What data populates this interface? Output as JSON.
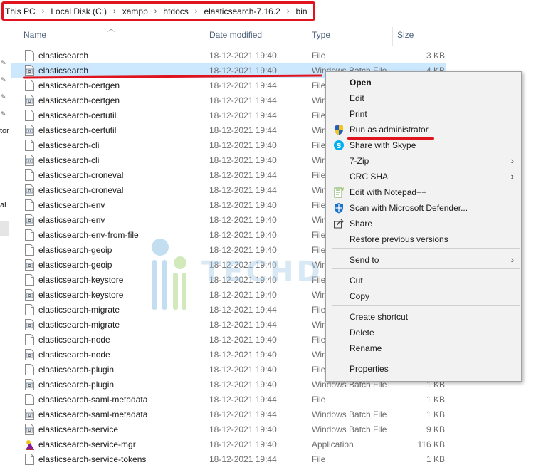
{
  "breadcrumb": [
    "This PC",
    "Local Disk (C:)",
    "xampp",
    "htdocs",
    "elasticsearch-7.16.2",
    "bin"
  ],
  "breadcrumb_separator": "›",
  "leftnav": {
    "fragments": [
      "tor",
      "al"
    ]
  },
  "columns": {
    "name": "Name",
    "date": "Date modified",
    "type": "Type",
    "size": "Size"
  },
  "files": [
    {
      "name": "elasticsearch",
      "date": "18-12-2021 19:40",
      "type": "File",
      "size": "3 KB",
      "icon": "file-icon"
    },
    {
      "name": "elasticsearch",
      "date": "18-12-2021 19:40",
      "type": "Windows Batch File",
      "size": "4 KB",
      "icon": "batch-file-icon",
      "selected": true
    },
    {
      "name": "elasticsearch-certgen",
      "date": "18-12-2021 19:44",
      "type": "File",
      "size": "",
      "icon": "file-icon"
    },
    {
      "name": "elasticsearch-certgen",
      "date": "18-12-2021 19:44",
      "type": "Win",
      "size": "",
      "icon": "batch-file-icon"
    },
    {
      "name": "elasticsearch-certutil",
      "date": "18-12-2021 19:44",
      "type": "File",
      "size": "",
      "icon": "file-icon"
    },
    {
      "name": "elasticsearch-certutil",
      "date": "18-12-2021 19:44",
      "type": "Win",
      "size": "",
      "icon": "batch-file-icon"
    },
    {
      "name": "elasticsearch-cli",
      "date": "18-12-2021 19:40",
      "type": "File",
      "size": "",
      "icon": "file-icon"
    },
    {
      "name": "elasticsearch-cli",
      "date": "18-12-2021 19:40",
      "type": "Win",
      "size": "",
      "icon": "batch-file-icon"
    },
    {
      "name": "elasticsearch-croneval",
      "date": "18-12-2021 19:44",
      "type": "File",
      "size": "",
      "icon": "file-icon"
    },
    {
      "name": "elasticsearch-croneval",
      "date": "18-12-2021 19:44",
      "type": "Win",
      "size": "",
      "icon": "batch-file-icon"
    },
    {
      "name": "elasticsearch-env",
      "date": "18-12-2021 19:40",
      "type": "File",
      "size": "",
      "icon": "file-icon"
    },
    {
      "name": "elasticsearch-env",
      "date": "18-12-2021 19:40",
      "type": "Win",
      "size": "",
      "icon": "batch-file-icon"
    },
    {
      "name": "elasticsearch-env-from-file",
      "date": "18-12-2021 19:40",
      "type": "File",
      "size": "",
      "icon": "file-icon"
    },
    {
      "name": "elasticsearch-geoip",
      "date": "18-12-2021 19:40",
      "type": "File",
      "size": "",
      "icon": "file-icon"
    },
    {
      "name": "elasticsearch-geoip",
      "date": "18-12-2021 19:40",
      "type": "Win",
      "size": "",
      "icon": "batch-file-icon"
    },
    {
      "name": "elasticsearch-keystore",
      "date": "18-12-2021 19:40",
      "type": "File",
      "size": "",
      "icon": "file-icon"
    },
    {
      "name": "elasticsearch-keystore",
      "date": "18-12-2021 19:40",
      "type": "Win",
      "size": "",
      "icon": "batch-file-icon"
    },
    {
      "name": "elasticsearch-migrate",
      "date": "18-12-2021 19:44",
      "type": "File",
      "size": "",
      "icon": "file-icon"
    },
    {
      "name": "elasticsearch-migrate",
      "date": "18-12-2021 19:44",
      "type": "Win",
      "size": "",
      "icon": "batch-file-icon"
    },
    {
      "name": "elasticsearch-node",
      "date": "18-12-2021 19:40",
      "type": "File",
      "size": "",
      "icon": "file-icon"
    },
    {
      "name": "elasticsearch-node",
      "date": "18-12-2021 19:40",
      "type": "Win",
      "size": "",
      "icon": "batch-file-icon"
    },
    {
      "name": "elasticsearch-plugin",
      "date": "18-12-2021 19:40",
      "type": "File",
      "size": "",
      "icon": "file-icon"
    },
    {
      "name": "elasticsearch-plugin",
      "date": "18-12-2021 19:40",
      "type": "Windows Batch File",
      "size": "1 KB",
      "icon": "batch-file-icon"
    },
    {
      "name": "elasticsearch-saml-metadata",
      "date": "18-12-2021 19:44",
      "type": "File",
      "size": "1 KB",
      "icon": "file-icon"
    },
    {
      "name": "elasticsearch-saml-metadata",
      "date": "18-12-2021 19:44",
      "type": "Windows Batch File",
      "size": "1 KB",
      "icon": "batch-file-icon"
    },
    {
      "name": "elasticsearch-service",
      "date": "18-12-2021 19:40",
      "type": "Windows Batch File",
      "size": "9 KB",
      "icon": "batch-file-icon"
    },
    {
      "name": "elasticsearch-service-mgr",
      "date": "18-12-2021 19:40",
      "type": "Application",
      "size": "116 KB",
      "icon": "application-icon"
    },
    {
      "name": "elasticsearch-service-tokens",
      "date": "18-12-2021 19:44",
      "type": "File",
      "size": "1 KB",
      "icon": "file-icon"
    }
  ],
  "context_menu": {
    "items": [
      {
        "label": "Open",
        "bold": true,
        "icon": "",
        "submenu": false
      },
      {
        "label": "Edit",
        "icon": "",
        "submenu": false
      },
      {
        "label": "Print",
        "icon": "",
        "submenu": false
      },
      {
        "label": "Run as administrator",
        "icon": "uac-shield-icon",
        "submenu": false
      },
      {
        "label": "Share with Skype",
        "icon": "skype-icon",
        "submenu": false
      },
      {
        "label": "7-Zip",
        "icon": "",
        "submenu": true
      },
      {
        "label": "CRC SHA",
        "icon": "",
        "submenu": true
      },
      {
        "label": "Edit with Notepad++",
        "icon": "notepadpp-icon",
        "submenu": false
      },
      {
        "label": "Scan with Microsoft Defender...",
        "icon": "defender-icon",
        "submenu": false
      },
      {
        "label": "Share",
        "icon": "share-icon",
        "submenu": false
      },
      {
        "label": "Restore previous versions",
        "icon": "",
        "submenu": false
      },
      {
        "label": "Send to",
        "icon": "",
        "submenu": true
      },
      {
        "label": "Cut",
        "icon": "",
        "submenu": false
      },
      {
        "label": "Copy",
        "icon": "",
        "submenu": false
      },
      {
        "label": "Create shortcut",
        "icon": "",
        "submenu": false
      },
      {
        "label": "Delete",
        "icon": "",
        "submenu": false
      },
      {
        "label": "Rename",
        "icon": "",
        "submenu": false
      },
      {
        "label": "Properties",
        "icon": "",
        "submenu": false
      }
    ]
  },
  "watermark_text": "TECHDECODE",
  "colors": {
    "annotation_red": "#e0141e",
    "selection": "#cce8ff",
    "header_text": "#4c607a",
    "menu_bg": "#f2f2f2"
  }
}
